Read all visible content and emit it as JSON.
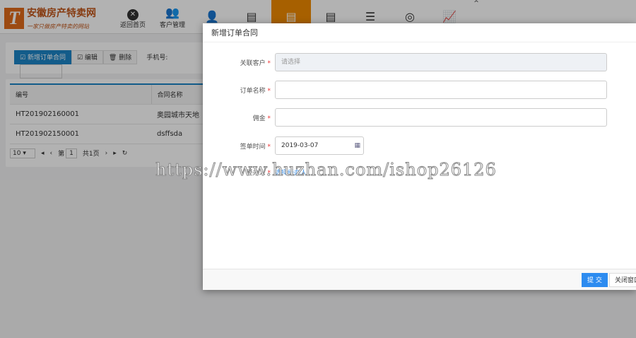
{
  "logo": {
    "title": "安徽房产特卖网",
    "slogan": "一家只做房产特卖的网站"
  },
  "nav": [
    {
      "label": "返回首页",
      "icon": "close-circle-icon"
    },
    {
      "label": "客户管理",
      "icon": "people-icon"
    },
    {
      "label": "",
      "icon": "user-icon"
    },
    {
      "label": "",
      "icon": "document-icon"
    },
    {
      "label": "",
      "icon": "document-icon"
    },
    {
      "label": "",
      "icon": "document-icon"
    },
    {
      "label": "",
      "icon": "list-icon"
    },
    {
      "label": "",
      "icon": "target-icon"
    },
    {
      "label": "",
      "icon": "chart-icon"
    }
  ],
  "toolbar": {
    "add": "新增订单合同",
    "edit": "编辑",
    "delete": "删除",
    "phone_label": "手机号:"
  },
  "table": {
    "headers": [
      "编号",
      "合同名称"
    ],
    "rows": [
      [
        "HT201902160001",
        "奥园城市天地"
      ],
      [
        "HT201902150001",
        "dsffsda"
      ]
    ]
  },
  "pager": {
    "page_size": "10",
    "page_prefix": "第",
    "page": "1",
    "total": "共1页"
  },
  "modal": {
    "title": "新增订单合同",
    "fields": {
      "customer_label": "关联客户",
      "customer_placeholder": "请选择",
      "name_label": "订单名称",
      "commission_label": "佣金",
      "date_label": "签单时间",
      "date_value": "2019-03-07",
      "agent_label": "经办人",
      "agent_link": "选择经办人"
    },
    "submit": "提 交",
    "close": "关闭窗口"
  },
  "watermark": "https://www.huzhan.com/ishop26126"
}
